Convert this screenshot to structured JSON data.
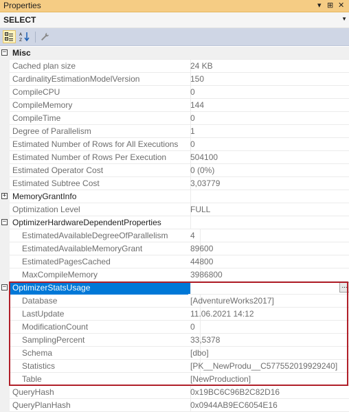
{
  "window": {
    "title": "Properties",
    "controls": {
      "pin": "▾",
      "dock": "⊞",
      "close": "✕"
    }
  },
  "object_selector": {
    "selected": "SELECT"
  },
  "toolbar": {
    "buttons": [
      {
        "name": "categorized-button",
        "active": true
      },
      {
        "name": "alphabetical-button",
        "active": false
      },
      {
        "name": "property-pages-button",
        "active": false
      }
    ]
  },
  "grid": {
    "misc": {
      "label": "Misc",
      "rows": [
        {
          "name": "Cached plan size",
          "value": "24 KB"
        },
        {
          "name": "CardinalityEstimationModelVersion",
          "value": "150"
        },
        {
          "name": "CompileCPU",
          "value": "0"
        },
        {
          "name": "CompileMemory",
          "value": "144"
        },
        {
          "name": "CompileTime",
          "value": "0"
        },
        {
          "name": "Degree of Parallelism",
          "value": "1"
        },
        {
          "name": "Estimated Number of Rows for All Executions",
          "value": "0"
        },
        {
          "name": "Estimated Number of Rows Per Execution",
          "value": "504100"
        },
        {
          "name": "Estimated Operator Cost",
          "value": "0 (0%)"
        },
        {
          "name": "Estimated Subtree Cost",
          "value": "3,03779"
        }
      ]
    },
    "memory_grant_info": {
      "label": "MemoryGrantInfo",
      "value": ""
    },
    "optimization_level": {
      "name": "Optimization Level",
      "value": "FULL"
    },
    "hardware": {
      "label": "OptimizerHardwareDependentProperties",
      "rows": [
        {
          "name": "EstimatedAvailableDegreeOfParallelism",
          "value": "4"
        },
        {
          "name": "EstimatedAvailableMemoryGrant",
          "value": "89600"
        },
        {
          "name": "EstimatedPagesCached",
          "value": "44800"
        },
        {
          "name": "MaxCompileMemory",
          "value": "3986800"
        }
      ]
    },
    "stats_usage": {
      "label": "OptimizerStatsUsage",
      "ellipsis": "...",
      "rows": [
        {
          "name": "Database",
          "value": "[AdventureWorks2017]"
        },
        {
          "name": "LastUpdate",
          "value": "11.06.2021 14:12"
        },
        {
          "name": "ModificationCount",
          "value": "0"
        },
        {
          "name": "SamplingPercent",
          "value": "33,5378"
        },
        {
          "name": "Schema",
          "value": "[dbo]"
        },
        {
          "name": "Statistics",
          "value": "[PK__NewProdu__C577552019929240]"
        },
        {
          "name": "Table",
          "value": "[NewProduction]"
        }
      ]
    },
    "tail": [
      {
        "name": "QueryHash",
        "value": "0x19BC6C96B2C82D16"
      },
      {
        "name": "QueryPlanHash",
        "value": "0x0944AB9EC6054E16"
      }
    ]
  },
  "colors": {
    "title_bar": "#f5cc84",
    "toolbar": "#cfd6e5",
    "selection": "#0078d7",
    "highlight_border": "#b01e28"
  }
}
